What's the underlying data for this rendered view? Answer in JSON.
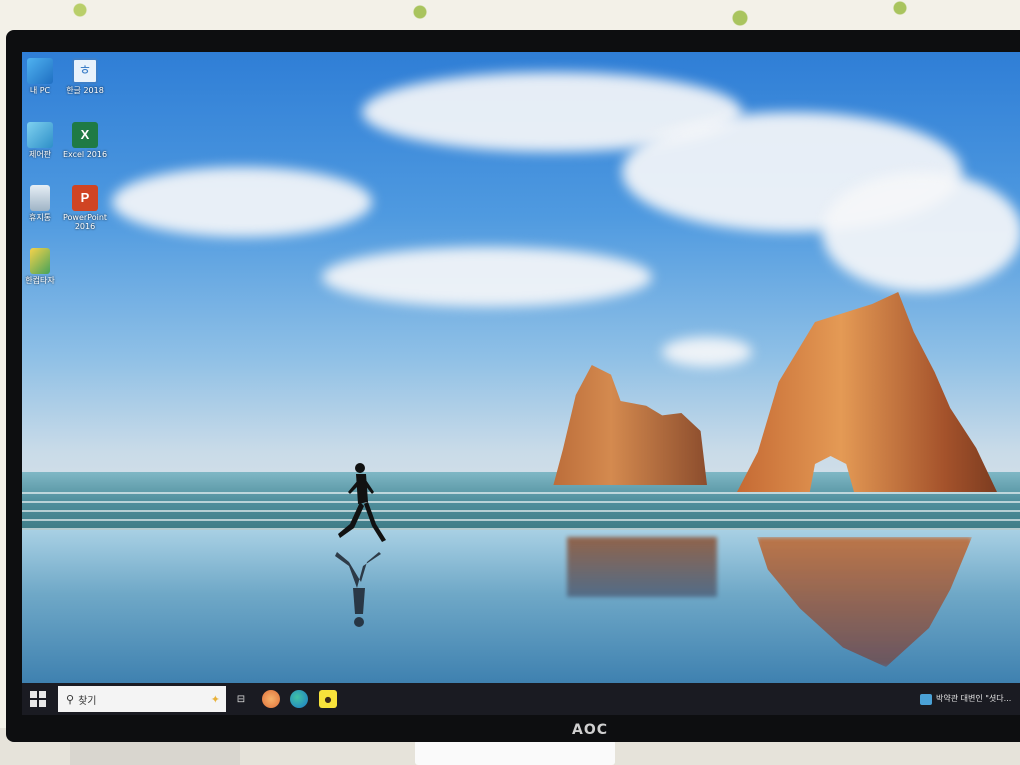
{
  "desktop": {
    "icons": [
      {
        "label": "내 PC",
        "icon": "computer-icon"
      },
      {
        "label": "한글 2018",
        "icon": "hangul-icon"
      },
      {
        "label": "제어판",
        "icon": "control-panel-icon"
      },
      {
        "label": "Excel 2016",
        "icon": "excel-icon"
      },
      {
        "label": "휴지통",
        "icon": "recycle-bin-icon"
      },
      {
        "label": "PowerPoint 2016",
        "icon": "powerpoint-icon"
      },
      {
        "label": "한컴타자",
        "icon": "hancom-typing-icon"
      }
    ]
  },
  "taskbar": {
    "search_placeholder": "찾기",
    "apps": [
      {
        "name": "task-view",
        "icon": "task-view-icon"
      },
      {
        "name": "browser-orange",
        "icon": "whale-browser-icon"
      },
      {
        "name": "edge",
        "icon": "edge-icon"
      },
      {
        "name": "kakaotalk",
        "icon": "kakaotalk-icon"
      }
    ],
    "tray_text": "박약관 대변인 \"셧다..."
  },
  "monitor": {
    "brand": "AOC"
  },
  "colors": {
    "taskbar": "#1a1b22",
    "search_box": "#f4f4f4",
    "excel": "#1f7a45",
    "powerpoint": "#d04423"
  }
}
